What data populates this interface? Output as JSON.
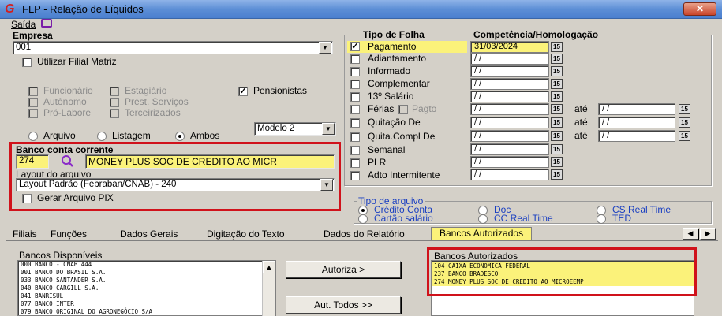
{
  "window": {
    "title": "FLP - Relação de Líquidos",
    "close_label": "✕"
  },
  "menu": {
    "saida": "Saída"
  },
  "empresa": {
    "label": "Empresa",
    "value": "001",
    "utilizar_filial": "Utilizar Filial Matriz"
  },
  "categorias": {
    "funcionario": "Funcionário",
    "estagiario": "Estagiário",
    "pensionistas": "Pensionistas",
    "autonomo": "Autônomo",
    "prest_servicos": "Prest. Serviços",
    "pro_labore": "Pró-Labore",
    "terceirizados": "Terceirizados"
  },
  "saida_tipo": {
    "arquivo": "Arquivo",
    "listagem": "Listagem",
    "ambos": "Ambos",
    "selected": "Ambos",
    "modelo": "Modelo 2"
  },
  "banco": {
    "label": "Banco conta corrente",
    "code": "274",
    "name": "MONEY PLUS SOC DE CREDITO AO MICR",
    "layout_label": "Layout do arquivo",
    "layout_value": "Layout Padrão (Febraban/CNAB) - 240",
    "gerar_pix": "Gerar Arquivo PIX"
  },
  "tipo_folha": {
    "header_tipo": "Tipo de Folha",
    "header_comp": "Competência/Homologação",
    "ate": "até",
    "empty_date": "/ /",
    "pagto": "Pagto",
    "items": [
      {
        "label": "Pagamento",
        "checked": true,
        "date": "31/03/2024"
      },
      {
        "label": "Adiantamento",
        "checked": false,
        "date": "/ /"
      },
      {
        "label": "Informado",
        "checked": false,
        "date": "/ /"
      },
      {
        "label": "Complementar",
        "checked": false,
        "date": "/ /"
      },
      {
        "label": "13º Salário",
        "checked": false,
        "date": "/ /"
      },
      {
        "label": "Férias",
        "checked": false,
        "date": "/ /"
      },
      {
        "label": "Quitação De",
        "checked": false,
        "date": "/ /"
      },
      {
        "label": "Quita.Compl De",
        "checked": false,
        "date": "/ /"
      },
      {
        "label": "Semanal",
        "checked": false,
        "date": "/ /"
      },
      {
        "label": "PLR",
        "checked": false,
        "date": "/ /"
      },
      {
        "label": "Adto Intermitente",
        "checked": false,
        "date": "/ /"
      }
    ]
  },
  "tipo_arquivo": {
    "label": "Tipo de arquivo",
    "credito_conta": "Crédito Conta",
    "cartao_salario": "Cartão salário",
    "doc": "Doc",
    "cc_real_time": "CC Real Time",
    "cs_real_time": "CS Real Time",
    "ted": "TED",
    "selected": "Crédito Conta"
  },
  "tabs": [
    "Filiais",
    "Funções",
    "Dados Gerais",
    "Digitação do Texto",
    "Dados do Relatório",
    "Bancos Autorizados"
  ],
  "active_tab": "Bancos Autorizados",
  "bancos_disponiveis": {
    "label": "Bancos Disponíveis",
    "items": [
      "000 BANCO - CNAB 444",
      "001 BANCO DO BRASIL S.A.",
      "033 BANCO SANTANDER S.A.",
      "040 BANCO CARGILL S.A.",
      "041 BANRISUL",
      "077 BANCO INTER",
      "079 BANCO ORIGINAL DO AGRONEGÓCIO S/A"
    ]
  },
  "buttons": {
    "autoriza": "Autoriza >",
    "aut_todos": "Aut. Todos >>"
  },
  "bancos_autorizados": {
    "label": "Bancos Autorizados",
    "items": [
      "104 CAIXA ECONOMICA FEDERAL",
      "237 BANCO BRADESCO",
      "274 MONEY PLUS SOC DE CREDITO AO MICROEEMP"
    ]
  },
  "colors": {
    "highlight": "#fbf27a",
    "annotation_red": "#d0121b",
    "title_blue": "#5d8fd6"
  }
}
